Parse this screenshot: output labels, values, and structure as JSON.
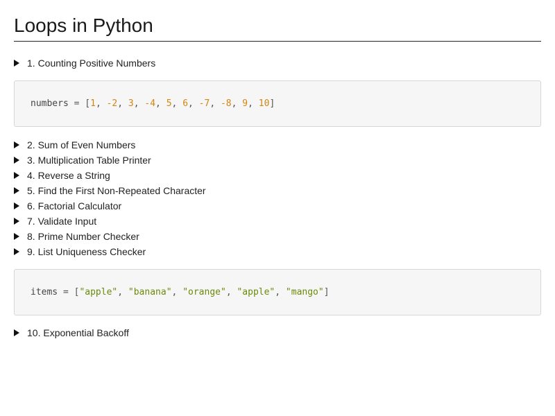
{
  "title": "Loops in Python",
  "items": [
    {
      "label": "1. Counting Positive Numbers"
    },
    {
      "label": "2. Sum of Even Numbers"
    },
    {
      "label": "3. Multiplication Table Printer"
    },
    {
      "label": "4. Reverse a String"
    },
    {
      "label": "5. Find the First Non-Repeated Character"
    },
    {
      "label": "6. Factorial Calculator"
    },
    {
      "label": "7. Validate Input"
    },
    {
      "label": "8. Prime Number Checker"
    },
    {
      "label": "9. List Uniqueness Checker"
    },
    {
      "label": "10. Exponential Backoff"
    }
  ],
  "code_blocks": {
    "numbers": {
      "var": "numbers",
      "values": [
        "1",
        "-2",
        "3",
        "-4",
        "5",
        "6",
        "-7",
        "-8",
        "9",
        "10"
      ]
    },
    "items": {
      "var": "items",
      "values": [
        "\"apple\"",
        "\"banana\"",
        "\"orange\"",
        "\"apple\"",
        "\"mango\""
      ]
    }
  },
  "colors": {
    "number_literal": "#d4850f",
    "string_literal": "#6a8a0a"
  },
  "icons": {
    "disclosure": "triangle-right-icon"
  }
}
